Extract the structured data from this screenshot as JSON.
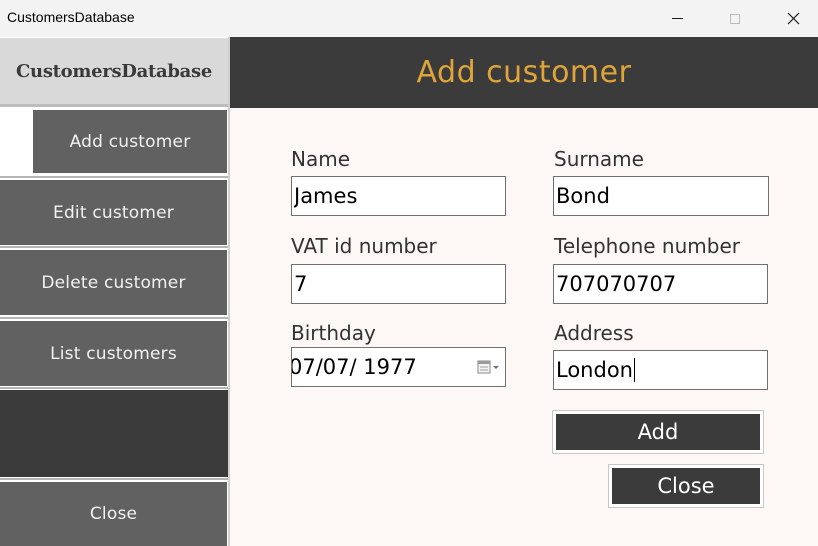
{
  "window": {
    "title": "CustomersDatabase",
    "minimize_icon": "minimize-icon",
    "maximize_icon": "maximize-icon",
    "close_icon": "close-icon"
  },
  "sidebar": {
    "brand": "CustomersDatabase",
    "items": [
      {
        "label": "Add customer",
        "active": true
      },
      {
        "label": "Edit customer",
        "active": false
      },
      {
        "label": "Delete customer",
        "active": false
      },
      {
        "label": "List customers",
        "active": false
      }
    ],
    "close_label": "Close"
  },
  "header": {
    "title": "Add customer"
  },
  "form": {
    "name_label": "Name",
    "name_value": "James",
    "surname_label": "Surname",
    "surname_value": "Bond",
    "vat_label": "VAT id number",
    "vat_value": "7",
    "phone_label": "Telephone number",
    "phone_value": "707070707",
    "birthday_label": "Birthday",
    "birthday_value": "07/07/ 1977",
    "birthday_icon": "calendar-icon",
    "address_label": "Address",
    "address_value": "London",
    "add_label": "Add",
    "close_label": "Close"
  },
  "colors": {
    "header_bg": "#3b3b3b",
    "header_title": "#e0a43a",
    "nav_button": "#616161",
    "content_bg": "#fdf7f5"
  }
}
